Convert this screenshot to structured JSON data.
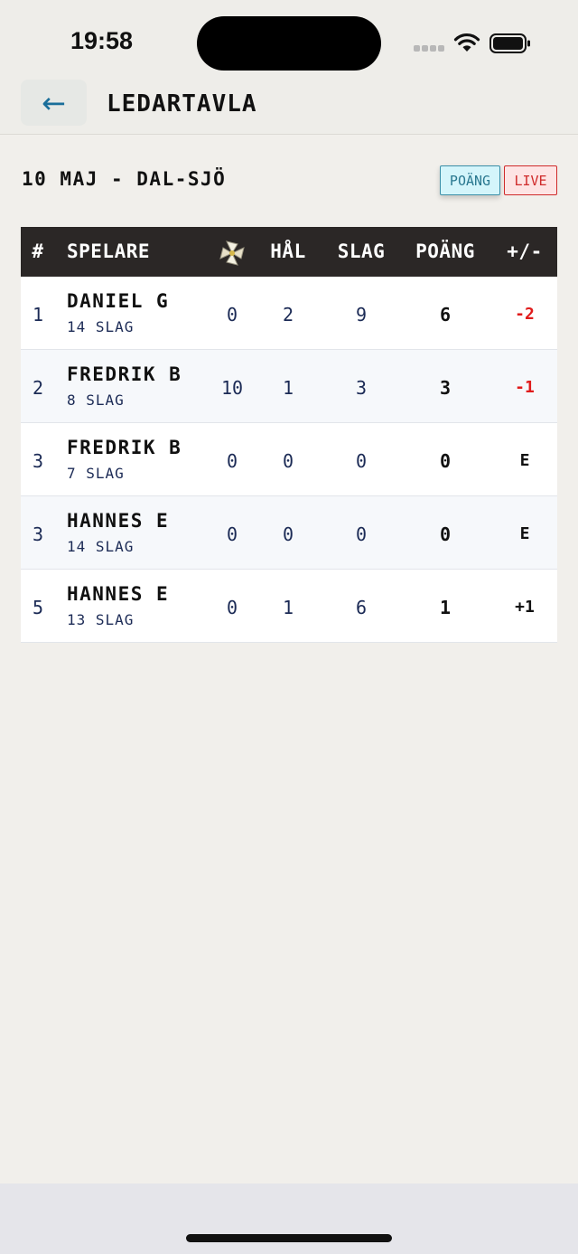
{
  "status_bar": {
    "time": "19:58"
  },
  "nav": {
    "back_label": "←",
    "title": "LEDARTAVLA"
  },
  "round": {
    "label": "10 MAJ - DAL-SJÖ"
  },
  "toggles": {
    "points": "POÄNG",
    "live": "LIVE"
  },
  "table": {
    "headers": {
      "rank": "#",
      "player": "SPELARE",
      "icon": "pinwheel-icon",
      "hal": "HÅL",
      "slag": "SLAG",
      "poang": "POÄNG",
      "diff": "+/-"
    },
    "rows": [
      {
        "rank": "1",
        "name": "DANIEL G",
        "strokes": "14 SLAG",
        "icon_val": "0",
        "hal": "2",
        "slag": "9",
        "poang": "6",
        "diff": "-2",
        "diff_color": "#e01b1b"
      },
      {
        "rank": "2",
        "name": "FREDRIK B",
        "strokes": "8 SLAG",
        "icon_val": "10",
        "hal": "1",
        "slag": "3",
        "poang": "3",
        "diff": "-1",
        "diff_color": "#e01b1b"
      },
      {
        "rank": "3",
        "name": "FREDRIK B",
        "strokes": "7 SLAG",
        "icon_val": "0",
        "hal": "0",
        "slag": "0",
        "poang": "0",
        "diff": "E",
        "diff_color": "#111111"
      },
      {
        "rank": "3",
        "name": "HANNES E",
        "strokes": "14 SLAG",
        "icon_val": "0",
        "hal": "0",
        "slag": "0",
        "poang": "0",
        "diff": "E",
        "diff_color": "#111111"
      },
      {
        "rank": "5",
        "name": "HANNES E",
        "strokes": "13 SLAG",
        "icon_val": "0",
        "hal": "1",
        "slag": "6",
        "poang": "1",
        "diff": "+1",
        "diff_color": "#111111"
      }
    ]
  }
}
